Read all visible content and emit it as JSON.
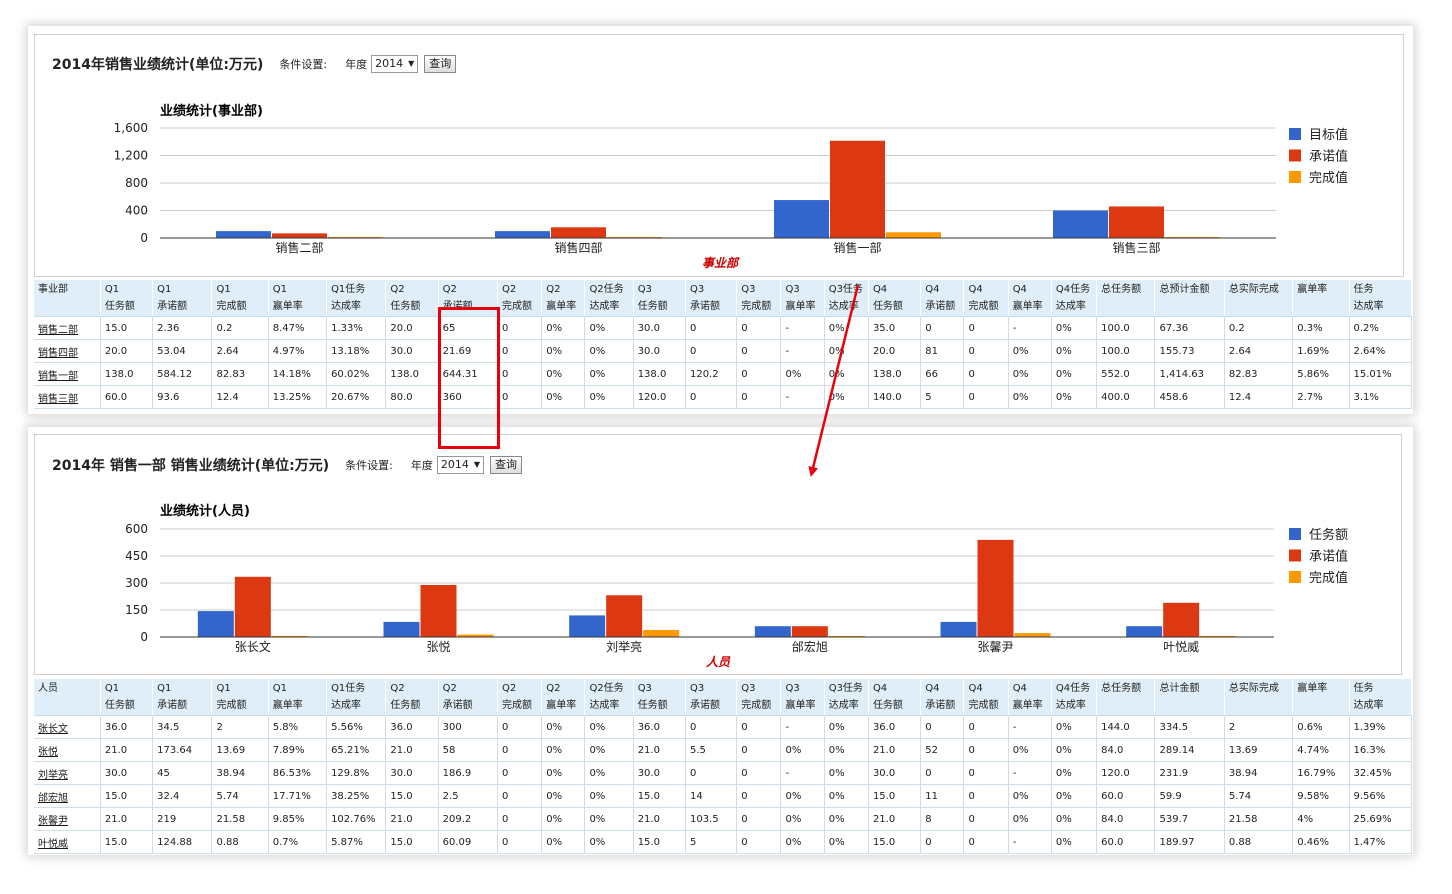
{
  "colors": {
    "blue": "#3366cc",
    "red": "#dc3912",
    "orange": "#ff9900",
    "pointer": "#e8000d"
  },
  "top": {
    "title": "2014年销售业绩统计(单位:万元)",
    "cond_label": "条件设置:",
    "year_label": "年度",
    "year_value": "2014",
    "query_button": "查询",
    "chart_title": "业绩统计(事业部)",
    "x_axis_label": "事业部",
    "columns": [
      [
        "事业部",
        ""
      ],
      [
        "Q1",
        "任务额"
      ],
      [
        "Q1",
        "承诺额"
      ],
      [
        "Q1",
        "完成额"
      ],
      [
        "Q1",
        "赢单率"
      ],
      [
        "Q1任务",
        "达成率"
      ],
      [
        "Q2",
        "任务额"
      ],
      [
        "Q2",
        "承诺额"
      ],
      [
        "Q2",
        "完成额"
      ],
      [
        "Q2",
        "赢单率"
      ],
      [
        "Q2任务",
        "达成率"
      ],
      [
        "Q3",
        "任务额"
      ],
      [
        "Q3",
        "承诺额"
      ],
      [
        "Q3",
        "完成额"
      ],
      [
        "Q3",
        "赢单率"
      ],
      [
        "Q3任务",
        "达成率"
      ],
      [
        "Q4",
        "任务额"
      ],
      [
        "Q4",
        "承诺额"
      ],
      [
        "Q4",
        "完成额"
      ],
      [
        "Q4",
        "赢单率"
      ],
      [
        "Q4任务",
        "达成率"
      ],
      [
        "总任务额",
        ""
      ],
      [
        "总预计金额",
        ""
      ],
      [
        "总实际完成",
        ""
      ],
      [
        "赢单率",
        ""
      ],
      [
        "任务",
        "达成率"
      ]
    ],
    "rows": [
      [
        "销售二部",
        "15.0",
        "2.36",
        "0.2",
        "8.47%",
        "1.33%",
        "20.0",
        "65",
        "0",
        "0%",
        "0%",
        "30.0",
        "0",
        "0",
        "-",
        "0%",
        "35.0",
        "0",
        "0",
        "-",
        "0%",
        "100.0",
        "67.36",
        "0.2",
        "0.3%",
        "0.2%"
      ],
      [
        "销售四部",
        "20.0",
        "53.04",
        "2.64",
        "4.97%",
        "13.18%",
        "30.0",
        "21.69",
        "0",
        "0%",
        "0%",
        "30.0",
        "0",
        "0",
        "-",
        "0%",
        "20.0",
        "81",
        "0",
        "0%",
        "0%",
        "100.0",
        "155.73",
        "2.64",
        "1.69%",
        "2.64%"
      ],
      [
        "销售一部",
        "138.0",
        "584.12",
        "82.83",
        "14.18%",
        "60.02%",
        "138.0",
        "644.31",
        "0",
        "0%",
        "0%",
        "138.0",
        "120.2",
        "0",
        "0%",
        "0%",
        "138.0",
        "66",
        "0",
        "0%",
        "0%",
        "552.0",
        "1,414.63",
        "82.83",
        "5.86%",
        "15.01%"
      ],
      [
        "销售三部",
        "60.0",
        "93.6",
        "12.4",
        "13.25%",
        "20.67%",
        "80.0",
        "360",
        "0",
        "0%",
        "0%",
        "120.0",
        "0",
        "0",
        "-",
        "0%",
        "140.0",
        "5",
        "0",
        "0%",
        "0%",
        "400.0",
        "458.6",
        "12.4",
        "2.7%",
        "3.1%"
      ]
    ]
  },
  "bottom": {
    "title": "2014年 销售一部 销售业绩统计(单位:万元)",
    "cond_label": "条件设置:",
    "year_label": "年度",
    "year_value": "2014",
    "query_button": "查询",
    "chart_title": "业绩统计(人员)",
    "x_axis_label": "人员",
    "columns": [
      [
        "人员",
        ""
      ],
      [
        "Q1",
        "任务额"
      ],
      [
        "Q1",
        "承诺额"
      ],
      [
        "Q1",
        "完成额"
      ],
      [
        "Q1",
        "赢单率"
      ],
      [
        "Q1任务",
        "达成率"
      ],
      [
        "Q2",
        "任务额"
      ],
      [
        "Q2",
        "承诺额"
      ],
      [
        "Q2",
        "完成额"
      ],
      [
        "Q2",
        "赢单率"
      ],
      [
        "Q2任务",
        "达成率"
      ],
      [
        "Q3",
        "任务额"
      ],
      [
        "Q3",
        "承诺额"
      ],
      [
        "Q3",
        "完成额"
      ],
      [
        "Q3",
        "赢单率"
      ],
      [
        "Q3任务",
        "达成率"
      ],
      [
        "Q4",
        "任务额"
      ],
      [
        "Q4",
        "承诺额"
      ],
      [
        "Q4",
        "完成额"
      ],
      [
        "Q4",
        "赢单率"
      ],
      [
        "Q4任务",
        "达成率"
      ],
      [
        "总任务额",
        ""
      ],
      [
        "总计金额",
        ""
      ],
      [
        "总实际完成",
        ""
      ],
      [
        "赢单率",
        ""
      ],
      [
        "任务",
        "达成率"
      ]
    ],
    "rows": [
      [
        "张长文",
        "36.0",
        "34.5",
        "2",
        "5.8%",
        "5.56%",
        "36.0",
        "300",
        "0",
        "0%",
        "0%",
        "36.0",
        "0",
        "0",
        "-",
        "0%",
        "36.0",
        "0",
        "0",
        "-",
        "0%",
        "144.0",
        "334.5",
        "2",
        "0.6%",
        "1.39%"
      ],
      [
        "张悦",
        "21.0",
        "173.64",
        "13.69",
        "7.89%",
        "65.21%",
        "21.0",
        "58",
        "0",
        "0%",
        "0%",
        "21.0",
        "5.5",
        "0",
        "0%",
        "0%",
        "21.0",
        "52",
        "0",
        "0%",
        "0%",
        "84.0",
        "289.14",
        "13.69",
        "4.74%",
        "16.3%"
      ],
      [
        "刘举亮",
        "30.0",
        "45",
        "38.94",
        "86.53%",
        "129.8%",
        "30.0",
        "186.9",
        "0",
        "0%",
        "0%",
        "30.0",
        "0",
        "0",
        "-",
        "0%",
        "30.0",
        "0",
        "0",
        "-",
        "0%",
        "120.0",
        "231.9",
        "38.94",
        "16.79%",
        "32.45%"
      ],
      [
        "邰宏旭",
        "15.0",
        "32.4",
        "5.74",
        "17.71%",
        "38.25%",
        "15.0",
        "2.5",
        "0",
        "0%",
        "0%",
        "15.0",
        "14",
        "0",
        "0%",
        "0%",
        "15.0",
        "11",
        "0",
        "0%",
        "0%",
        "60.0",
        "59.9",
        "5.74",
        "9.58%",
        "9.56%"
      ],
      [
        "张馨尹",
        "21.0",
        "219",
        "21.58",
        "9.85%",
        "102.76%",
        "21.0",
        "209.2",
        "0",
        "0%",
        "0%",
        "21.0",
        "103.5",
        "0",
        "0%",
        "0%",
        "21.0",
        "8",
        "0",
        "0%",
        "0%",
        "84.0",
        "539.7",
        "21.58",
        "4%",
        "25.69%"
      ],
      [
        "叶悦威",
        "15.0",
        "124.88",
        "0.88",
        "0.7%",
        "5.87%",
        "15.0",
        "60.09",
        "0",
        "0%",
        "0%",
        "15.0",
        "5",
        "0",
        "0%",
        "0%",
        "15.0",
        "0",
        "0",
        "-",
        "0%",
        "60.0",
        "189.97",
        "0.88",
        "0.46%",
        "1.47%"
      ]
    ]
  },
  "chart_data": [
    {
      "type": "bar",
      "title": "业绩统计(事业部)",
      "xlabel": "事业部",
      "categories": [
        "销售二部",
        "销售四部",
        "销售一部",
        "销售三部"
      ],
      "series": [
        {
          "name": "目标值",
          "values": [
            100,
            100,
            552,
            400
          ]
        },
        {
          "name": "承诺值",
          "values": [
            67.36,
            155.73,
            1414.63,
            458.6
          ]
        },
        {
          "name": "完成值",
          "values": [
            0.2,
            2.64,
            82.83,
            12.4
          ]
        }
      ],
      "yticks": [
        "0",
        "400",
        "800",
        "1,200",
        "1,600"
      ],
      "ylim": [
        0,
        1600
      ],
      "legend": "right",
      "grid": true
    },
    {
      "type": "bar",
      "title": "业绩统计(人员)",
      "xlabel": "人员",
      "categories": [
        "张长文",
        "张悦",
        "刘举亮",
        "邰宏旭",
        "张馨尹",
        "叶悦威"
      ],
      "series": [
        {
          "name": "任务额",
          "values": [
            144,
            84,
            120,
            60,
            84,
            60
          ]
        },
        {
          "name": "承诺值",
          "values": [
            334.5,
            289.14,
            231.9,
            59.9,
            539.7,
            189.97
          ]
        },
        {
          "name": "完成值",
          "values": [
            2,
            13.69,
            38.94,
            5.74,
            21.58,
            0.88
          ]
        }
      ],
      "yticks": [
        "0",
        "150",
        "300",
        "450",
        "600"
      ],
      "ylim": [
        0,
        600
      ],
      "legend": "right",
      "grid": true
    }
  ]
}
